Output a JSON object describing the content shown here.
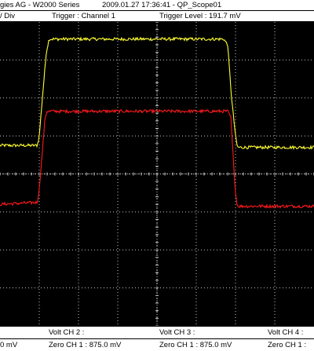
{
  "header": {
    "device": "gies AG - W2000 Series",
    "timestamp": "2009.01.27 17:36:41 - QP_Scope01",
    "scale": "/ Div",
    "trigger_source": "Trigger : Channel 1",
    "trigger_level": "Trigger Level : 191.7 mV"
  },
  "footer": {
    "volt_ch2": "Volt CH 2 :",
    "volt_ch3": "Volt CH 3 :",
    "volt_ch4": "Volt CH 4 :",
    "zero_left": "0 mV",
    "zero_ch1_a": "Zero CH 1 : 875.0 mV",
    "zero_ch1_b": "Zero CH 1 : 875.0 mV",
    "zero_ch1_c": "Zero CH 1 :"
  },
  "colors": {
    "background": "#000000",
    "grid": "#c8c8c8",
    "channel_1": "#ffff33",
    "channel_2": "#ff1a1a"
  },
  "chart_data": {
    "type": "line",
    "grid": true,
    "x_divisions": 8,
    "y_divisions": 8,
    "xlim": [
      0,
      8
    ],
    "ylim": [
      0,
      8
    ],
    "series": [
      {
        "color": "#ffff33",
        "x": [
          0,
          0.95,
          1.0,
          1.08,
          1.18,
          1.25,
          3.0,
          5.7,
          5.8,
          5.9,
          6.0,
          6.05,
          8.0
        ],
        "y": [
          4.75,
          4.75,
          5.0,
          6.0,
          7.2,
          7.55,
          7.55,
          7.55,
          7.4,
          6.0,
          5.0,
          4.7,
          4.7
        ],
        "noise": 0.04
      },
      {
        "color": "#ff1a1a",
        "x": [
          0,
          0.95,
          1.0,
          1.08,
          1.15,
          1.2,
          3.0,
          5.8,
          5.88,
          5.95,
          6.0,
          6.05,
          8.0
        ],
        "y": [
          3.2,
          3.25,
          3.6,
          4.6,
          5.5,
          5.65,
          5.65,
          5.65,
          5.5,
          4.3,
          3.5,
          3.15,
          3.15
        ],
        "noise": 0.04
      }
    ]
  }
}
